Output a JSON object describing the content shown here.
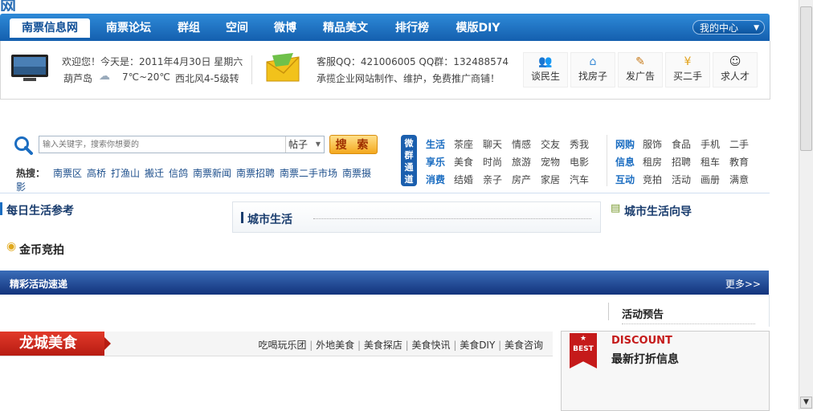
{
  "site_logo": "网",
  "nav": {
    "items": [
      "南票信息网",
      "南票论坛",
      "群组",
      "空间",
      "微博",
      "精品美文",
      "排行榜",
      "模版DIY"
    ],
    "my_center": "我的中心"
  },
  "info": {
    "welcome": "欢迎您！今天是：2011年4月30日 星期六",
    "city": "葫芦岛",
    "weather": "7℃~20℃",
    "wind": "西北风4-5级转",
    "service": "客服QQ：421006005 QQ群：132488574",
    "promo": "承揽企业网站制作、维护，免费推广商铺！",
    "quick_links": [
      "谈民生",
      "找房子",
      "发广告",
      "买二手",
      "求人才"
    ]
  },
  "search": {
    "placeholder": "输入关键字，搜索你想要的",
    "select_value": "帖子",
    "button": "搜 索",
    "hot_label": "热搜：",
    "hot_links": [
      "南票区",
      "高桥",
      "打渔山",
      "搬迁",
      "信鸽",
      "南票新闻",
      "南票招聘",
      "南票二手市场",
      "南票摄",
      "影"
    ],
    "channel_badge": "微群通道",
    "channels": [
      {
        "label": "生活",
        "items": [
          "茶座",
          "聊天",
          "情感",
          "交友",
          "秀我"
        ]
      },
      {
        "label": "享乐",
        "items": [
          "美食",
          "时尚",
          "旅游",
          "宠物",
          "电影"
        ]
      },
      {
        "label": "消费",
        "items": [
          "结婚",
          "亲子",
          "房产",
          "家居",
          "汽车"
        ]
      }
    ],
    "channels2": [
      {
        "label": "网购",
        "items": [
          "服饰",
          "食品",
          "手机",
          "二手"
        ]
      },
      {
        "label": "信息",
        "items": [
          "租房",
          "招聘",
          "租车",
          "教育"
        ]
      },
      {
        "label": "互动",
        "items": [
          "竞拍",
          "活动",
          "画册",
          "满意"
        ]
      }
    ]
  },
  "sections": {
    "daily": "每日生活参考",
    "city_life": "城市生活",
    "guide": "城市生活向导",
    "auction": "金币竞拍",
    "cut_text": "一一"
  },
  "banner": {
    "title": "精彩活动速递",
    "more": "更多>>",
    "preview": "活动预告"
  },
  "food": {
    "title": "龙城美食",
    "links": [
      "吃喝玩乐团",
      "外地美食",
      "美食探店",
      "美食快讯",
      "美食DIY",
      "美食咨询"
    ]
  },
  "discount": {
    "badge": "BEST",
    "en": "DISCOUNT",
    "cn": "最新打折信息"
  },
  "colors": {
    "nav_blue": "#1b6dc1",
    "banner_blue": "#13337c",
    "food_red": "#c8261a",
    "search_orange": "#f4a81e"
  }
}
